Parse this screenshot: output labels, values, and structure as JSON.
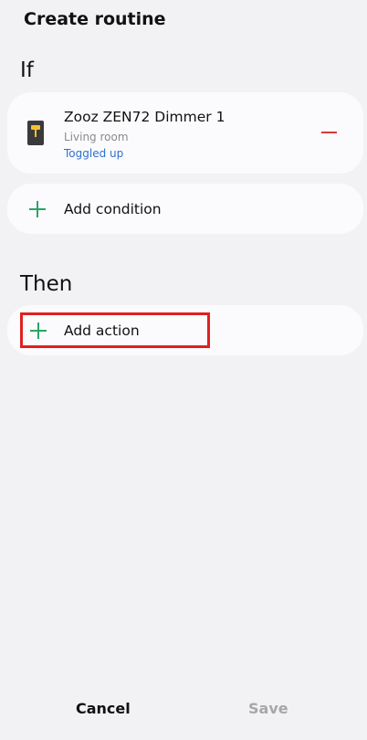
{
  "header": {
    "title": "Create routine"
  },
  "if_section": {
    "title": "If",
    "device": {
      "icon": "dimmer-switch-icon",
      "name": "Zooz ZEN72 Dimmer 1",
      "room": "Living room",
      "state": "Toggled up",
      "remove_icon": "minus-icon"
    },
    "add_condition": {
      "icon": "plus-icon",
      "label": "Add condition"
    }
  },
  "then_section": {
    "title": "Then",
    "add_action": {
      "icon": "plus-icon",
      "label": "Add action"
    }
  },
  "footer": {
    "cancel_label": "Cancel",
    "save_label": "Save"
  },
  "colors": {
    "background": "#f2f2f4",
    "card": "#fbfbfd",
    "accent_green": "#2aa566",
    "remove_red": "#d63a3a",
    "link_blue": "#2f6fd1",
    "highlight_red": "#e02020",
    "disabled_gray": "#a7a7ab"
  }
}
